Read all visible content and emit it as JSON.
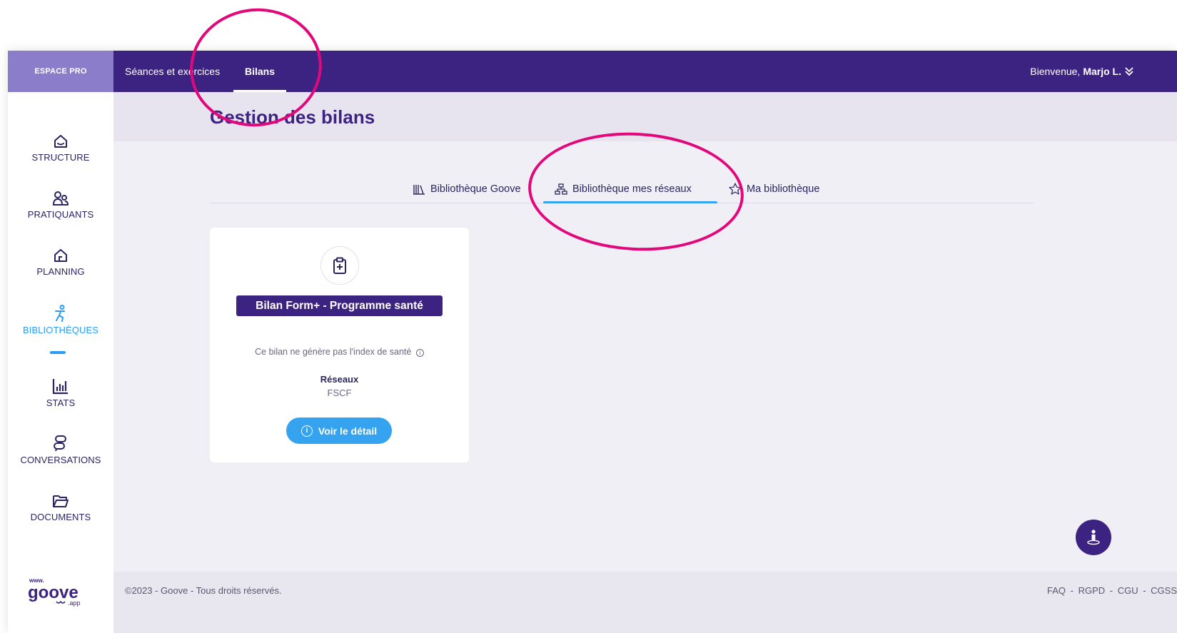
{
  "brand": {
    "label": "ESPACE PRO"
  },
  "topnav": {
    "items": [
      {
        "label": "Séances et exercices"
      },
      {
        "label": "Bilans"
      }
    ],
    "welcome_prefix": "Bienvenue,",
    "user_name": "Marjo L."
  },
  "sidebar": {
    "items": [
      {
        "label": "STRUCTURE",
        "icon": "structure-house-icon"
      },
      {
        "label": "PRATIQUANTS",
        "icon": "users-icon"
      },
      {
        "label": "PLANNING",
        "icon": "planning-house-icon"
      },
      {
        "label": "BIBLIOTHÈQUES",
        "icon": "runner-icon"
      },
      {
        "label": "STATS",
        "icon": "bar-chart-icon"
      },
      {
        "label": "CONVERSATIONS",
        "icon": "chat-icon"
      },
      {
        "label": "DOCUMENTS",
        "icon": "folder-icon"
      }
    ],
    "logo": {
      "top": "www.",
      "main": "goove",
      "sub": ".app"
    }
  },
  "page": {
    "title": "Gestion des bilans"
  },
  "tabs": [
    {
      "label": "Bibliothèque Goove",
      "icon": "books-icon"
    },
    {
      "label": "Bibliothèque mes réseaux",
      "icon": "network-icon"
    },
    {
      "label": "Ma bibliothèque",
      "icon": "star-icon"
    }
  ],
  "card": {
    "title": "Bilan Form+ - Programme santé",
    "note": "Ce bilan ne génère pas l'index de santé",
    "info_glyph": "i",
    "networks_label": "Réseaux",
    "networks_value": "FSCF",
    "button_label": "Voir le détail"
  },
  "footer": {
    "copyright": "©2023 - Goove - Tous droits réservés.",
    "links": "FAQ - RGPD - CGU - CGSS"
  },
  "colors": {
    "primary": "#3d2381",
    "accent": "#35a3f0",
    "annotation": "#e2087c"
  }
}
